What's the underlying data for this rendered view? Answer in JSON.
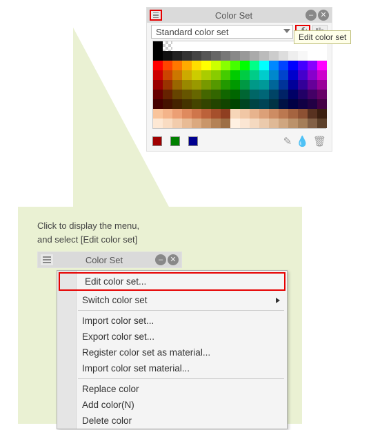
{
  "top_panel": {
    "title": "Color Set",
    "dropdown_value": "Standard color set",
    "wrench_icon": "wrench",
    "lib_icon": "library",
    "tooltip": "Edit color set",
    "footer_chips": [
      "#a00000",
      "#008000",
      "#000090"
    ]
  },
  "callout": {
    "line1": "Click to display the menu,",
    "line2": "and select [Edit color set]"
  },
  "mini_panel": {
    "title": "Color Set"
  },
  "menu": {
    "edit": "Edit color set...",
    "switch": "Switch color set",
    "imp": "Import color set...",
    "exp": "Export color set...",
    "reg": "Register color set as material...",
    "impmat": "Import color set material...",
    "replace": "Replace color",
    "add": "Add color(N)",
    "delete": "Delete color"
  },
  "swatch_rows": [
    [
      "#000",
      "transp",
      "#fff",
      "#fff",
      "#fff",
      "#fff",
      "#fff",
      "#fff",
      "#fff",
      "#fff",
      "#fff",
      "#fff",
      "#fff",
      "#fff",
      "#fff",
      "#fff",
      "#fff",
      "#fff"
    ],
    [
      "#000",
      "#111",
      "#222",
      "#333",
      "#444",
      "#555",
      "#666",
      "#777",
      "#888",
      "#999",
      "#aaa",
      "#bbb",
      "#ccc",
      "#ddd",
      "#eee",
      "#f7f7f7",
      "#fff",
      "#fff"
    ],
    [
      "#f00",
      "#f40",
      "#f70",
      "#fa0",
      "#fd0",
      "#ff0",
      "#cf0",
      "#8f0",
      "#4f0",
      "#0f0",
      "#0f8",
      "#0ff",
      "#08f",
      "#04f",
      "#00f",
      "#40f",
      "#80f",
      "#f0f"
    ],
    [
      "#c00",
      "#c40",
      "#c70",
      "#ca0",
      "#cc0",
      "#ac0",
      "#8c0",
      "#4c0",
      "#0c0",
      "#0c4",
      "#0c8",
      "#0cc",
      "#08c",
      "#04c",
      "#00c",
      "#40c",
      "#80c",
      "#c0c"
    ],
    [
      "#900",
      "#930",
      "#960",
      "#980",
      "#990",
      "#790",
      "#590",
      "#290",
      "#090",
      "#094",
      "#098",
      "#099",
      "#069",
      "#039",
      "#009",
      "#309",
      "#609",
      "#909"
    ],
    [
      "#600",
      "#620",
      "#640",
      "#650",
      "#660",
      "#460",
      "#360",
      "#160",
      "#060",
      "#063",
      "#066",
      "#067",
      "#046",
      "#026",
      "#006",
      "#206",
      "#406",
      "#606"
    ],
    [
      "#400",
      "#410",
      "#420",
      "#430",
      "#440",
      "#340",
      "#240",
      "#140",
      "#040",
      "#042",
      "#044",
      "#045",
      "#034",
      "#014",
      "#004",
      "#104",
      "#204",
      "#404"
    ],
    [
      "#f9c49b",
      "#f4b48a",
      "#ec9f74",
      "#df8a5e",
      "#cf764b",
      "#bc623a",
      "#a6502c",
      "#8f3f21",
      "#f6d6b8",
      "#f1c7a5",
      "#e7b38d",
      "#dca078",
      "#cd8c63",
      "#bb7850",
      "#a56440",
      "#8d5133",
      "#583220",
      "#3b1f10"
    ],
    [
      "#fde8d4",
      "#f9dcc2",
      "#f2ccac",
      "#e8bb95",
      "#dba97f",
      "#c9966a",
      "#b48256",
      "#9d6f46",
      "#fff1e2",
      "#fbe6d3",
      "#f4d9c0",
      "#ebcaac",
      "#dfb996",
      "#cfa680",
      "#bb926b",
      "#a57e59",
      "#826046",
      "#5c402a"
    ]
  ]
}
